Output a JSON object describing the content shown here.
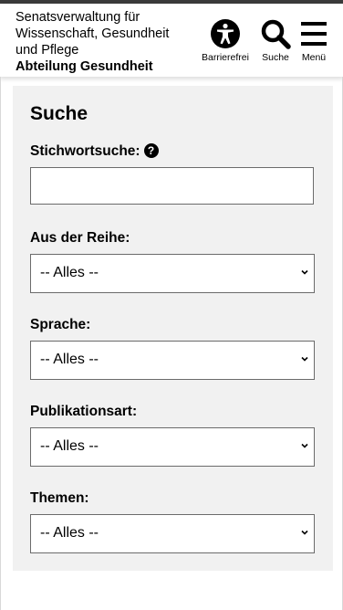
{
  "header": {
    "org_lines": [
      "Senatsverwaltung für",
      "Wissenschaft, Gesundheit",
      "und Pflege"
    ],
    "department": "Abteilung Gesundheit",
    "buttons": [
      {
        "icon": "accessibility-icon",
        "label": "Barrierefrei"
      },
      {
        "icon": "search-icon",
        "label": "Suche"
      },
      {
        "icon": "hamburger-menu-icon",
        "label": "Menü"
      }
    ]
  },
  "search": {
    "title": "Suche",
    "keyword_label": "Stichwortsuche:",
    "keyword_help_icon": "question-circle-icon",
    "keyword_value": "",
    "filters": [
      {
        "label": "Aus der Reihe:",
        "selected": "-- Alles --"
      },
      {
        "label": "Sprache:",
        "selected": "-- Alles --"
      },
      {
        "label": "Publikationsart:",
        "selected": "-- Alles --"
      },
      {
        "label": "Themen:",
        "selected": "-- Alles --"
      }
    ]
  },
  "colors": {
    "panel_bg": "#f1f1f1",
    "topbar": "#3a3a3a",
    "border": "#6b6b6b"
  }
}
